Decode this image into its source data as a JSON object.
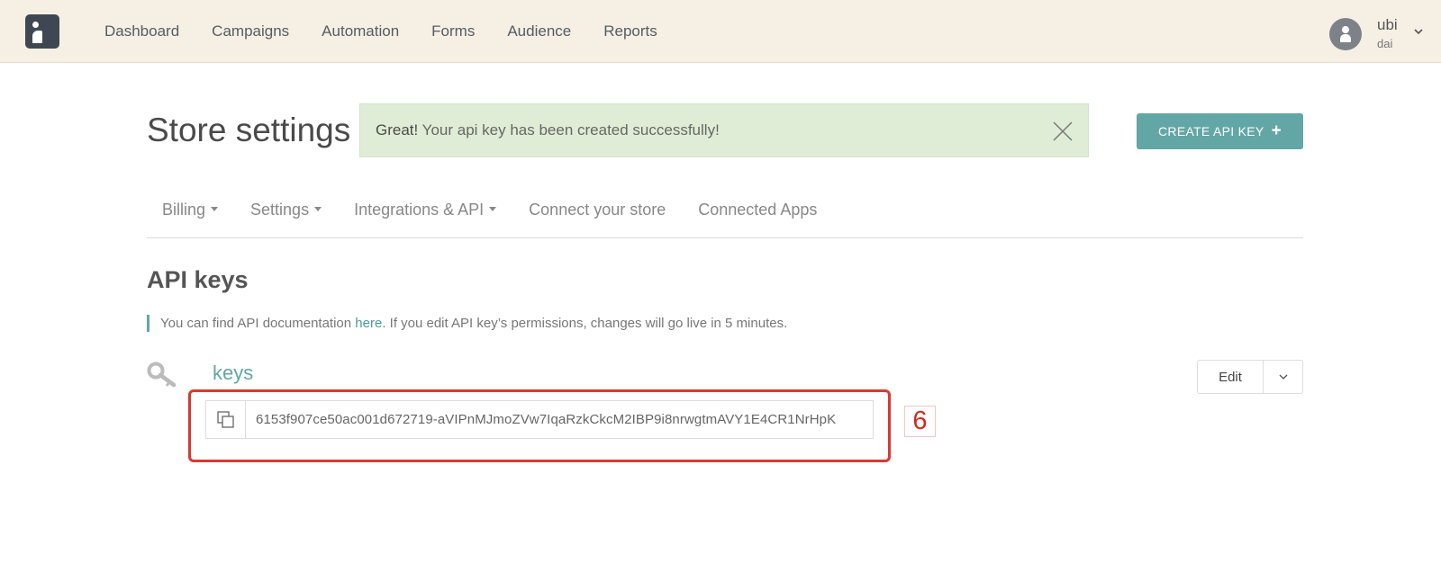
{
  "nav": {
    "items": [
      "Dashboard",
      "Campaigns",
      "Automation",
      "Forms",
      "Audience",
      "Reports"
    ],
    "user": {
      "name": "ubi",
      "sub": "dai"
    }
  },
  "header": {
    "title": "Store settings",
    "alert": {
      "strong": "Great!",
      "text": " Your api key has been created successfully!"
    },
    "create_button": "CREATE API KEY"
  },
  "tabs": [
    {
      "label": "Billing",
      "dropdown": true
    },
    {
      "label": "Settings",
      "dropdown": true
    },
    {
      "label": "Integrations & API",
      "dropdown": true
    },
    {
      "label": "Connect your store",
      "dropdown": false
    },
    {
      "label": "Connected Apps",
      "dropdown": false
    }
  ],
  "section": {
    "title": "API keys",
    "info_before": "You can find API documentation ",
    "info_link": "here",
    "info_after": ". If you edit API key’s permissions, changes will go live in 5 minutes."
  },
  "key": {
    "name": "keys",
    "value": "6153f907ce50ac001d672719-aVIPnMJmoZVw7IqaRzkCkcM2IBP9i8nrwgtmAVY1E4CR1NrHpK",
    "edit_label": "Edit",
    "badge": "6"
  },
  "colors": {
    "accent": "#63a6a6",
    "topbar": "#f6efe4",
    "alert_bg": "#e0edd6",
    "highlight": "#d83a31"
  },
  "icons": {
    "logo": "brand-logo-icon",
    "avatar": "user-avatar-icon",
    "close": "close-icon",
    "key": "key-icon",
    "copy": "copy-icon",
    "caret": "chevron-down-icon",
    "plus": "plus-icon"
  }
}
